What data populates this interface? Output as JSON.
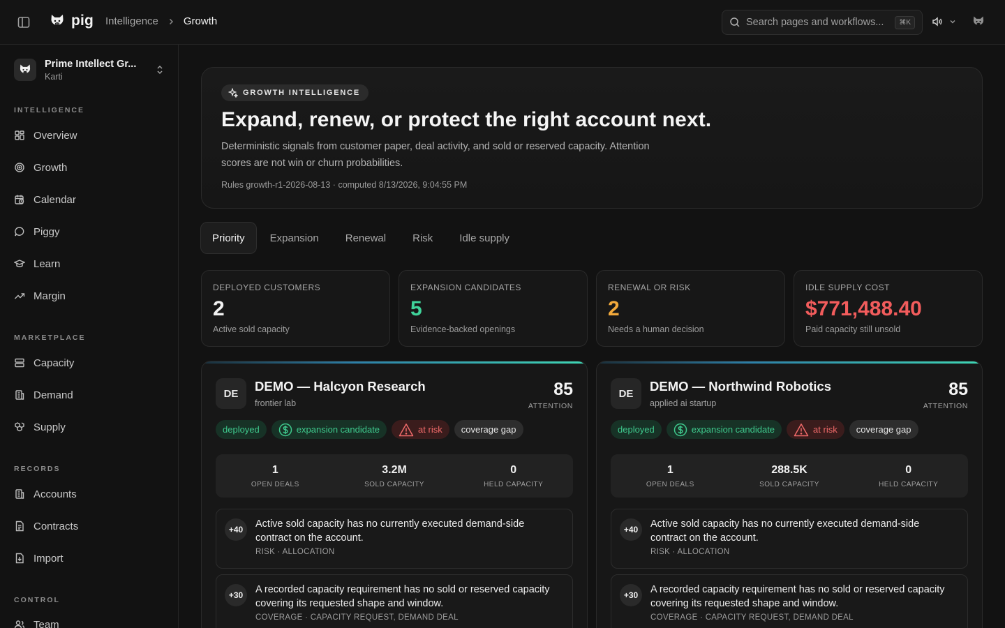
{
  "topbar": {
    "brand": "pig",
    "breadcrumb": {
      "parent": "Intelligence",
      "current": "Growth"
    },
    "search_placeholder": "Search pages and workflows...",
    "search_shortcut": "⌘K"
  },
  "sidebar": {
    "org": {
      "name": "Prime Intellect Gr...",
      "user": "Karti"
    },
    "sections": {
      "intelligence": "INTELLIGENCE",
      "marketplace": "MARKETPLACE",
      "records": "RECORDS",
      "control": "CONTROL"
    },
    "items": {
      "overview": "Overview",
      "growth": "Growth",
      "calendar": "Calendar",
      "piggy": "Piggy",
      "learn": "Learn",
      "margin": "Margin",
      "capacity": "Capacity",
      "demand": "Demand",
      "supply": "Supply",
      "accounts": "Accounts",
      "contracts": "Contracts",
      "import": "Import",
      "team": "Team"
    }
  },
  "hero": {
    "badge": "GROWTH INTELLIGENCE",
    "title": "Expand, renew, or protect the right account next.",
    "description": "Deterministic signals from customer paper, deal activity, and sold or reserved capacity. Attention scores are not win or churn probabilities.",
    "meta": "Rules growth-r1-2026-08-13 · computed 8/13/2026, 9:04:55 PM"
  },
  "tabs": [
    "Priority",
    "Expansion",
    "Renewal",
    "Risk",
    "Idle supply"
  ],
  "stats": [
    {
      "label": "DEPLOYED CUSTOMERS",
      "value": "2",
      "sub": "Active sold capacity",
      "color": "#f2f2f2"
    },
    {
      "label": "EXPANSION CANDIDATES",
      "value": "5",
      "sub": "Evidence-backed openings",
      "color": "#3fd39a"
    },
    {
      "label": "RENEWAL OR RISK",
      "value": "2",
      "sub": "Needs a human decision",
      "color": "#f2a93b"
    },
    {
      "label": "IDLE SUPPLY COST",
      "value": "$771,488.40",
      "sub": "Paid capacity still unsold",
      "color": "#f25c5c"
    }
  ],
  "accounts": [
    {
      "initials": "DE",
      "name": "DEMO — Halcyon Research",
      "type": "frontier lab",
      "score": "85",
      "score_label": "ATTENTION",
      "tags": {
        "deployed": "deployed",
        "expansion": "expansion candidate",
        "risk": "at risk",
        "coverage": "coverage gap"
      },
      "metrics": [
        {
          "value": "1",
          "label": "OPEN DEALS"
        },
        {
          "value": "3.2M",
          "label": "SOLD CAPACITY"
        },
        {
          "value": "0",
          "label": "HELD CAPACITY"
        }
      ],
      "signals": [
        {
          "points": "+40",
          "text": "Active sold capacity has no currently executed demand-side contract on the account.",
          "meta": "RISK · ALLOCATION"
        },
        {
          "points": "+30",
          "text": "A recorded capacity requirement has no sold or reserved capacity covering its requested shape and window.",
          "meta": "COVERAGE · CAPACITY REQUEST, DEMAND DEAL"
        }
      ]
    },
    {
      "initials": "DE",
      "name": "DEMO — Northwind Robotics",
      "type": "applied ai startup",
      "score": "85",
      "score_label": "ATTENTION",
      "tags": {
        "deployed": "deployed",
        "expansion": "expansion candidate",
        "risk": "at risk",
        "coverage": "coverage gap"
      },
      "metrics": [
        {
          "value": "1",
          "label": "OPEN DEALS"
        },
        {
          "value": "288.5K",
          "label": "SOLD CAPACITY"
        },
        {
          "value": "0",
          "label": "HELD CAPACITY"
        }
      ],
      "signals": [
        {
          "points": "+40",
          "text": "Active sold capacity has no currently executed demand-side contract on the account.",
          "meta": "RISK · ALLOCATION"
        },
        {
          "points": "+30",
          "text": "A recorded capacity requirement has no sold or reserved capacity covering its requested shape and window.",
          "meta": "COVERAGE · CAPACITY REQUEST, DEMAND DEAL"
        }
      ]
    }
  ]
}
